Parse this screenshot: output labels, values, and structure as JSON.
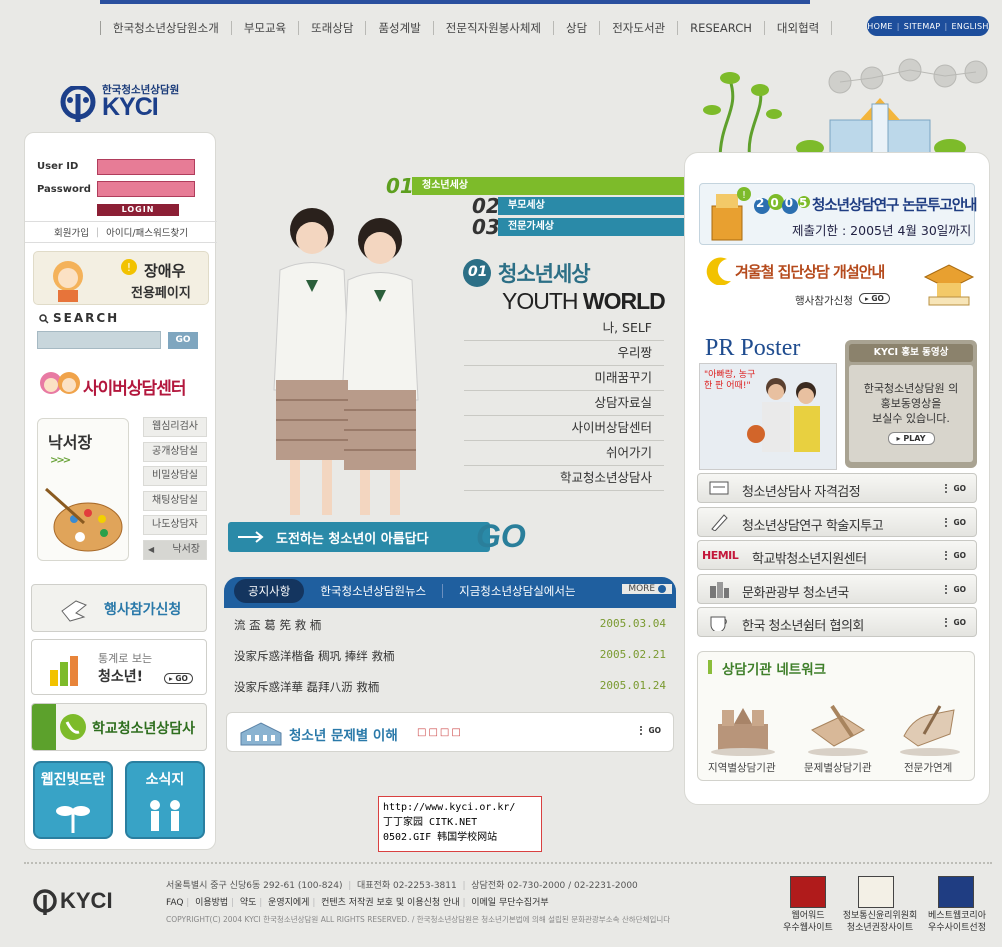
{
  "nav": {
    "items": [
      "한국청소년상담원소개",
      "부모교육",
      "또래상담",
      "품성계발",
      "전문직자원봉사체제",
      "상담",
      "전자도서관",
      "RESEARCH",
      "대외협력"
    ],
    "util": [
      "HOME",
      "SITEMAP",
      "ENGLISH"
    ]
  },
  "logo": {
    "ko": "한국청소년상담원",
    "en": "KYCI"
  },
  "login": {
    "user_label": "User ID",
    "pass_label": "Password",
    "button": "LOGIN",
    "join": "회원가입",
    "find": "아이디/패스워드찾기"
  },
  "promo_left": {
    "name": "장애우",
    "sub": "전용페이지"
  },
  "search": {
    "title": "SEARCH",
    "button": "GO"
  },
  "cyber": {
    "title": "사이버상담센터"
  },
  "board": {
    "title": "낙서장",
    "arrows": ">>>",
    "items": [
      "웹심리검사",
      "공개상담실",
      "비밀상담실",
      "채팅상담실",
      "나도상담자",
      "낙서장"
    ]
  },
  "left_banners": {
    "event": "행사참가신청",
    "stats_1": "통계로 보는",
    "stats_2": "청소년!",
    "school": "학교청소년상담사",
    "webzine": "웹진빛뜨란",
    "news": "소식지",
    "go": "GO"
  },
  "menu": {
    "tabs": [
      {
        "num": "01",
        "label": "청소년세상"
      },
      {
        "num": "02",
        "label": "부모세상"
      },
      {
        "num": "03",
        "label": "전문가세상"
      }
    ],
    "title_num": "01",
    "title_ko": "청소년세상",
    "title_en_1": "YOUTH ",
    "title_en_2": "WORLD",
    "sub": [
      "나, SELF",
      "우리짱",
      "미래꿈꾸기",
      "상담자료실",
      "사이버상담센터",
      "쉬어가기",
      "학교청소년상담사"
    ]
  },
  "go_banner": {
    "text": "도전하는 청소년이 아름답다",
    "go": "GO"
  },
  "news": {
    "tabs": [
      "공지사항",
      "한국청소년상담원뉴스",
      "지금청소년상담실에서는"
    ],
    "more": "MORE",
    "rows": [
      {
        "title": "流 盃 葛 筅 救 栭",
        "date": "2005.03.04"
      },
      {
        "title": "没家斥惑洋楷备 稠巩 捧绊 救栭",
        "date": "2005.02.21"
      },
      {
        "title": "没家斥惑洋華 磊拜八沥 救栭",
        "date": "2005.01.24"
      }
    ]
  },
  "problem": {
    "title": "청소년 문제별 이해",
    "dots": "□□□□",
    "go": "GO"
  },
  "right": {
    "thesis_year": "2005",
    "thesis_title": "청소년상담연구 논문투고안내",
    "thesis_deadline": "제출기한 : 2005년 4월 30일까지",
    "winter_title": "겨울철 집단상담 개설안내",
    "winter_sub": "행사참가신청",
    "pr_title": "PR Poster",
    "pr_quote": "\"아빠랑, 농구 한 판 어때!\"",
    "promo_head": "KYCI 홍보 동영상",
    "promo_body_1": "한국청소년상담원 의",
    "promo_body_2": "홍보동영상을",
    "promo_body_3": "보실수 있습니다.",
    "promo_play": "PLAY",
    "links": [
      "청소년상담사 자격검정",
      "청소년상담연구 학술지투고",
      "학교밖청소년지원센터",
      "문화관광부 청소년국",
      "한국 청소년쉼터 협의회"
    ],
    "hemil": "HEMIL",
    "go": "GO",
    "network_title": "상담기관 네트워크",
    "network_items": [
      "지역별상담기관",
      "문제별상담기관",
      "전문가연계"
    ]
  },
  "watermark": [
    "http://www.kyci.or.kr/",
    "丁丁家园 CITK.NET",
    "0502.GIF 韩国学校网站"
  ],
  "footer": {
    "address": "서울특별시 중구 신당6동 292-61 (100-824)",
    "tel": "대표전화 02-2253-3811",
    "counsel": "상담전화 02-730-2000 / 02-2231-2000",
    "links": [
      "FAQ",
      "이용방법",
      "약도",
      "운영지에게",
      "컨텐츠 저작권 보호 및 이용신청 안내",
      "이메일 무단수집거부"
    ],
    "copyright": "COPYRIGHT(C) 2004 KYCI 한국청소년상담원 ALL RIGHTS RESERVED. / 한국청소년상담원은 청소년기본법에 의해 설립된 문화관광부소속 산하단체입니다",
    "logo": "KYCI",
    "badges": [
      {
        "l1": "웹어워드",
        "l2": "우수웹사이트"
      },
      {
        "l1": "정보통신윤리위원회",
        "l2": "청소년권장사이트"
      },
      {
        "l1": "베스트웹코리아",
        "l2": "우수사이트선정"
      }
    ]
  },
  "colors": {
    "nav_blue": "#1d4e9c",
    "accent_green": "#7dbb2a",
    "teal": "#2a8aa8",
    "login_pink": "#e77c96"
  }
}
